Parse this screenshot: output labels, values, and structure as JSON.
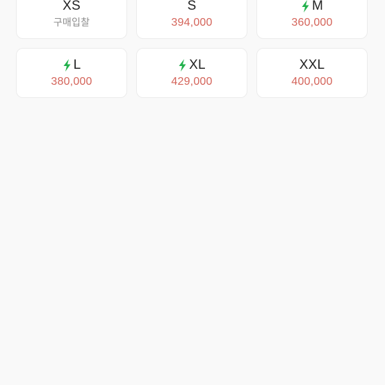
{
  "colors": {
    "background": "#f9f9f9",
    "card": "#ffffff",
    "card_border": "#ebebeb",
    "price_red": "#d4645a",
    "text_gray": "#8c8c8c",
    "bolt_green": "#22b14c"
  },
  "sizes": [
    {
      "label": "XS",
      "express": false,
      "price": "구매입찰",
      "price_style": "gray"
    },
    {
      "label": "S",
      "express": false,
      "price": "394,000",
      "price_style": "red"
    },
    {
      "label": "M",
      "express": true,
      "price": "360,000",
      "price_style": "red"
    },
    {
      "label": "L",
      "express": true,
      "price": "380,000",
      "price_style": "red"
    },
    {
      "label": "XL",
      "express": true,
      "price": "429,000",
      "price_style": "red"
    },
    {
      "label": "XXL",
      "express": false,
      "price": "400,000",
      "price_style": "red"
    }
  ],
  "icons": {
    "express": "lightning-bolt-icon"
  }
}
